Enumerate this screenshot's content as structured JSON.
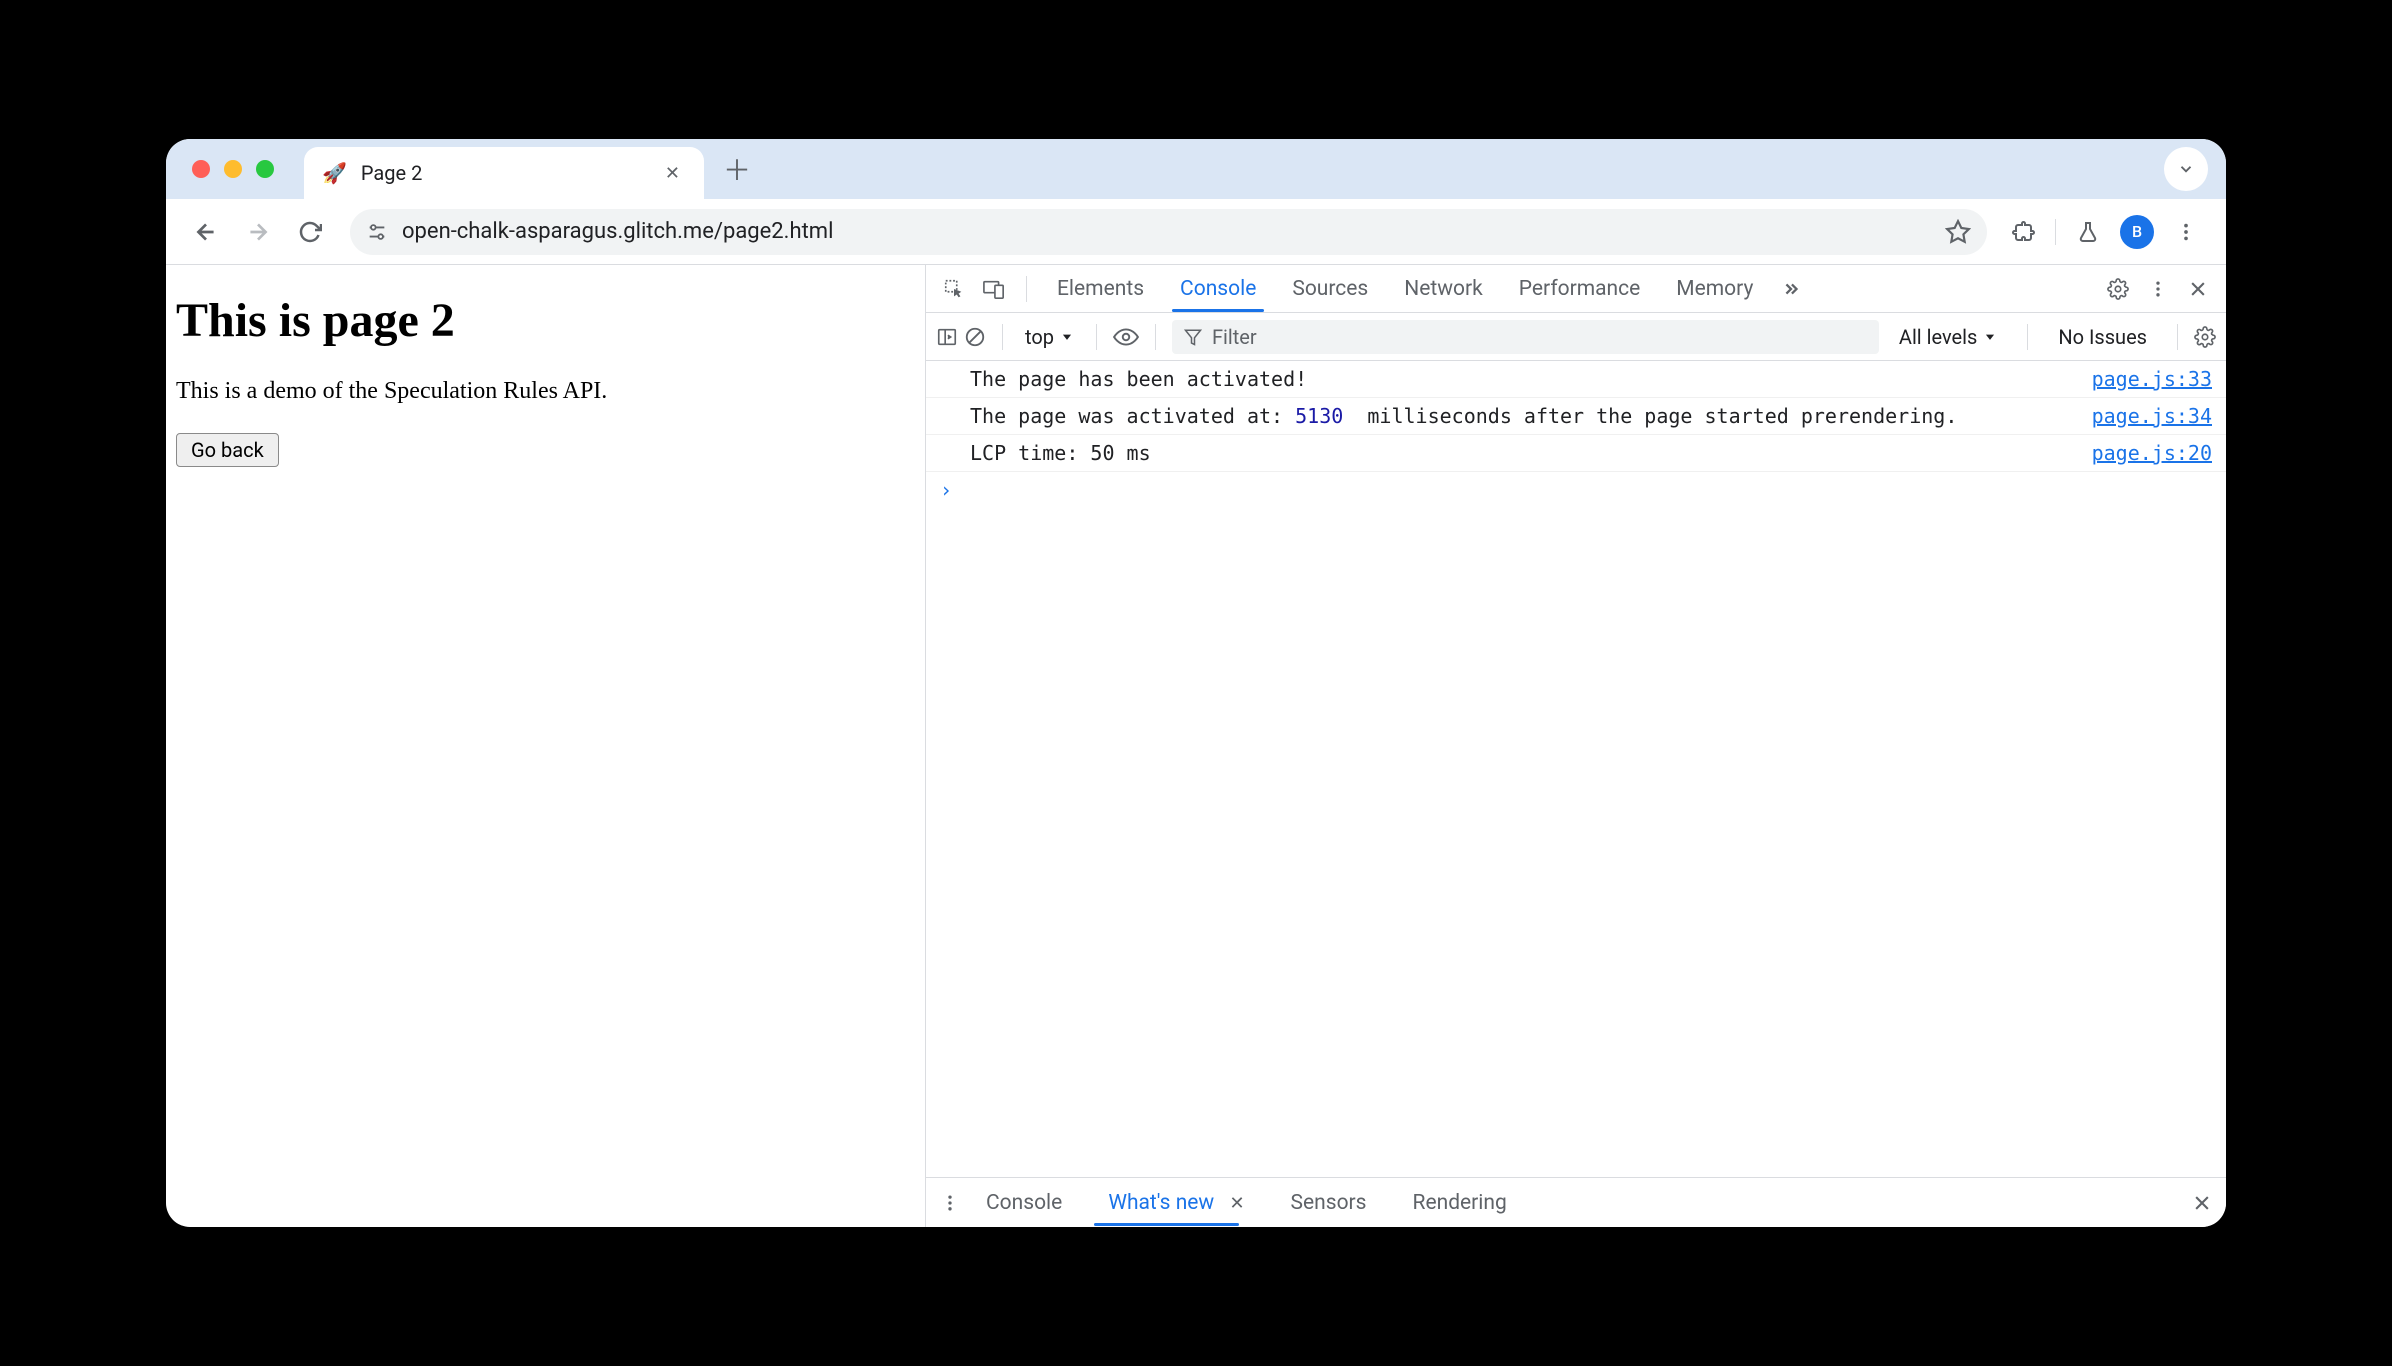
{
  "browser": {
    "tab_title": "Page 2",
    "favicon": "🚀",
    "url": "open-chalk-asparagus.glitch.me/page2.html",
    "avatar_initial": "B"
  },
  "page": {
    "heading": "This is page 2",
    "paragraph": "This is a demo of the Speculation Rules API.",
    "button_label": "Go back"
  },
  "devtools": {
    "tabs": {
      "elements": "Elements",
      "console": "Console",
      "sources": "Sources",
      "network": "Network",
      "performance": "Performance",
      "memory": "Memory"
    },
    "toolbar": {
      "context": "top",
      "filter_placeholder": "Filter",
      "levels": "All levels",
      "issues": "No Issues"
    },
    "logs": [
      {
        "text_a": "The page has been activated!",
        "num": "",
        "text_b": "",
        "source": "page.js:33"
      },
      {
        "text_a": "The page was activated at: ",
        "num": "5130",
        "text_b": "  milliseconds after the page started prerendering.",
        "source": "page.js:34"
      },
      {
        "text_a": "LCP time: 50 ms",
        "num": "",
        "text_b": "",
        "source": "page.js:20"
      }
    ],
    "drawer": {
      "console": "Console",
      "whats_new": "What's new",
      "sensors": "Sensors",
      "rendering": "Rendering"
    }
  }
}
